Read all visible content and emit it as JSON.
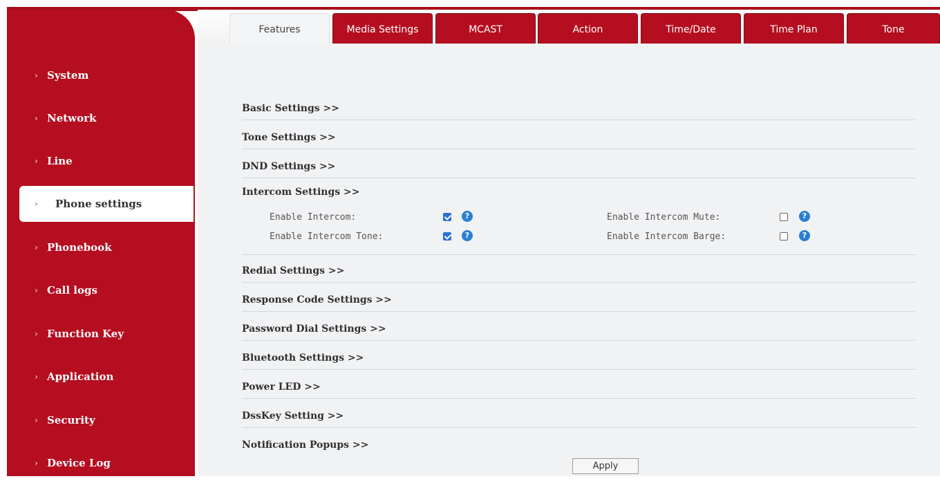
{
  "tabs": [
    {
      "label": "Features",
      "active": true
    },
    {
      "label": "Media Settings",
      "active": false
    },
    {
      "label": "MCAST",
      "active": false
    },
    {
      "label": "Action",
      "active": false
    },
    {
      "label": "Time/Date",
      "active": false
    },
    {
      "label": "Time Plan",
      "active": false
    },
    {
      "label": "Tone",
      "active": false
    }
  ],
  "sidebar": {
    "items": [
      {
        "label": "System"
      },
      {
        "label": "Network"
      },
      {
        "label": "Line"
      },
      {
        "label": "Phone settings",
        "active": true
      },
      {
        "label": "Phonebook"
      },
      {
        "label": "Call logs"
      },
      {
        "label": "Function Key"
      },
      {
        "label": "Application"
      },
      {
        "label": "Security"
      },
      {
        "label": "Device Log"
      }
    ],
    "chevron": "›"
  },
  "sections": {
    "basic": "Basic Settings >>",
    "tone": "Tone Settings >>",
    "dnd": "DND Settings >>",
    "intercom": "Intercom Settings >>",
    "redial": "Redial Settings >>",
    "response_code": "Response Code Settings >>",
    "password_dial": "Password Dial Settings >>",
    "bluetooth": "Bluetooth Settings >>",
    "power_led": "Power LED >>",
    "dsskey": "DssKey Setting >>",
    "notification": "Notification Popups >>"
  },
  "intercom": {
    "enable_intercom": {
      "label": "Enable Intercom:",
      "checked": true
    },
    "enable_intercom_mute": {
      "label": "Enable Intercom Mute:",
      "checked": false
    },
    "enable_intercom_tone": {
      "label": "Enable Intercom Tone:",
      "checked": true
    },
    "enable_intercom_barge": {
      "label": "Enable Intercom Barge:",
      "checked": false
    },
    "help_glyph": "?"
  },
  "apply_label": "Apply",
  "colors": {
    "brand": "#b50e20",
    "accent": "#2d6fd6"
  }
}
